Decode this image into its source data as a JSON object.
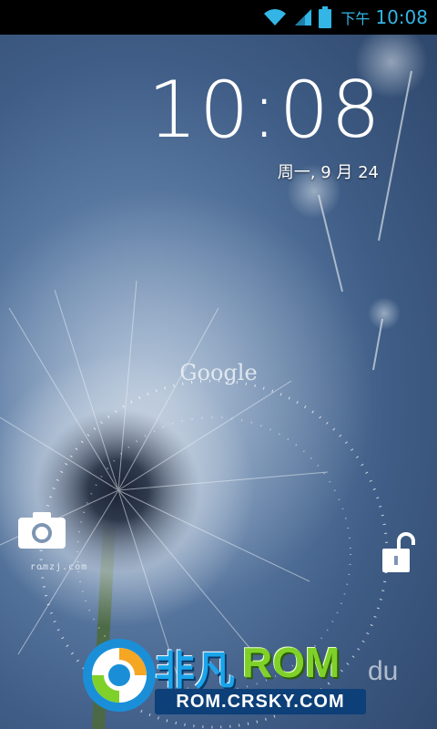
{
  "status_bar": {
    "ampm": "下午",
    "time": "10:08",
    "icons": [
      "wifi-icon",
      "signal-icon",
      "battery-icon"
    ]
  },
  "lockscreen": {
    "clock": "10:08",
    "date": "周一, 9 月 24",
    "search_brand": "Google",
    "left_target_icon": "camera-icon",
    "right_target_icon": "unlock-icon",
    "watermark_small": "romzj.com"
  },
  "promo": {
    "brand_cn": "非凡",
    "brand_rom": "ROM",
    "url": "ROM.CRSKY.COM",
    "tail_text": "du"
  },
  "colors": {
    "status_accent": "#33b5e5",
    "wallpaper_dark": "#2d4569",
    "wallpaper_light": "#8aa4c4"
  }
}
